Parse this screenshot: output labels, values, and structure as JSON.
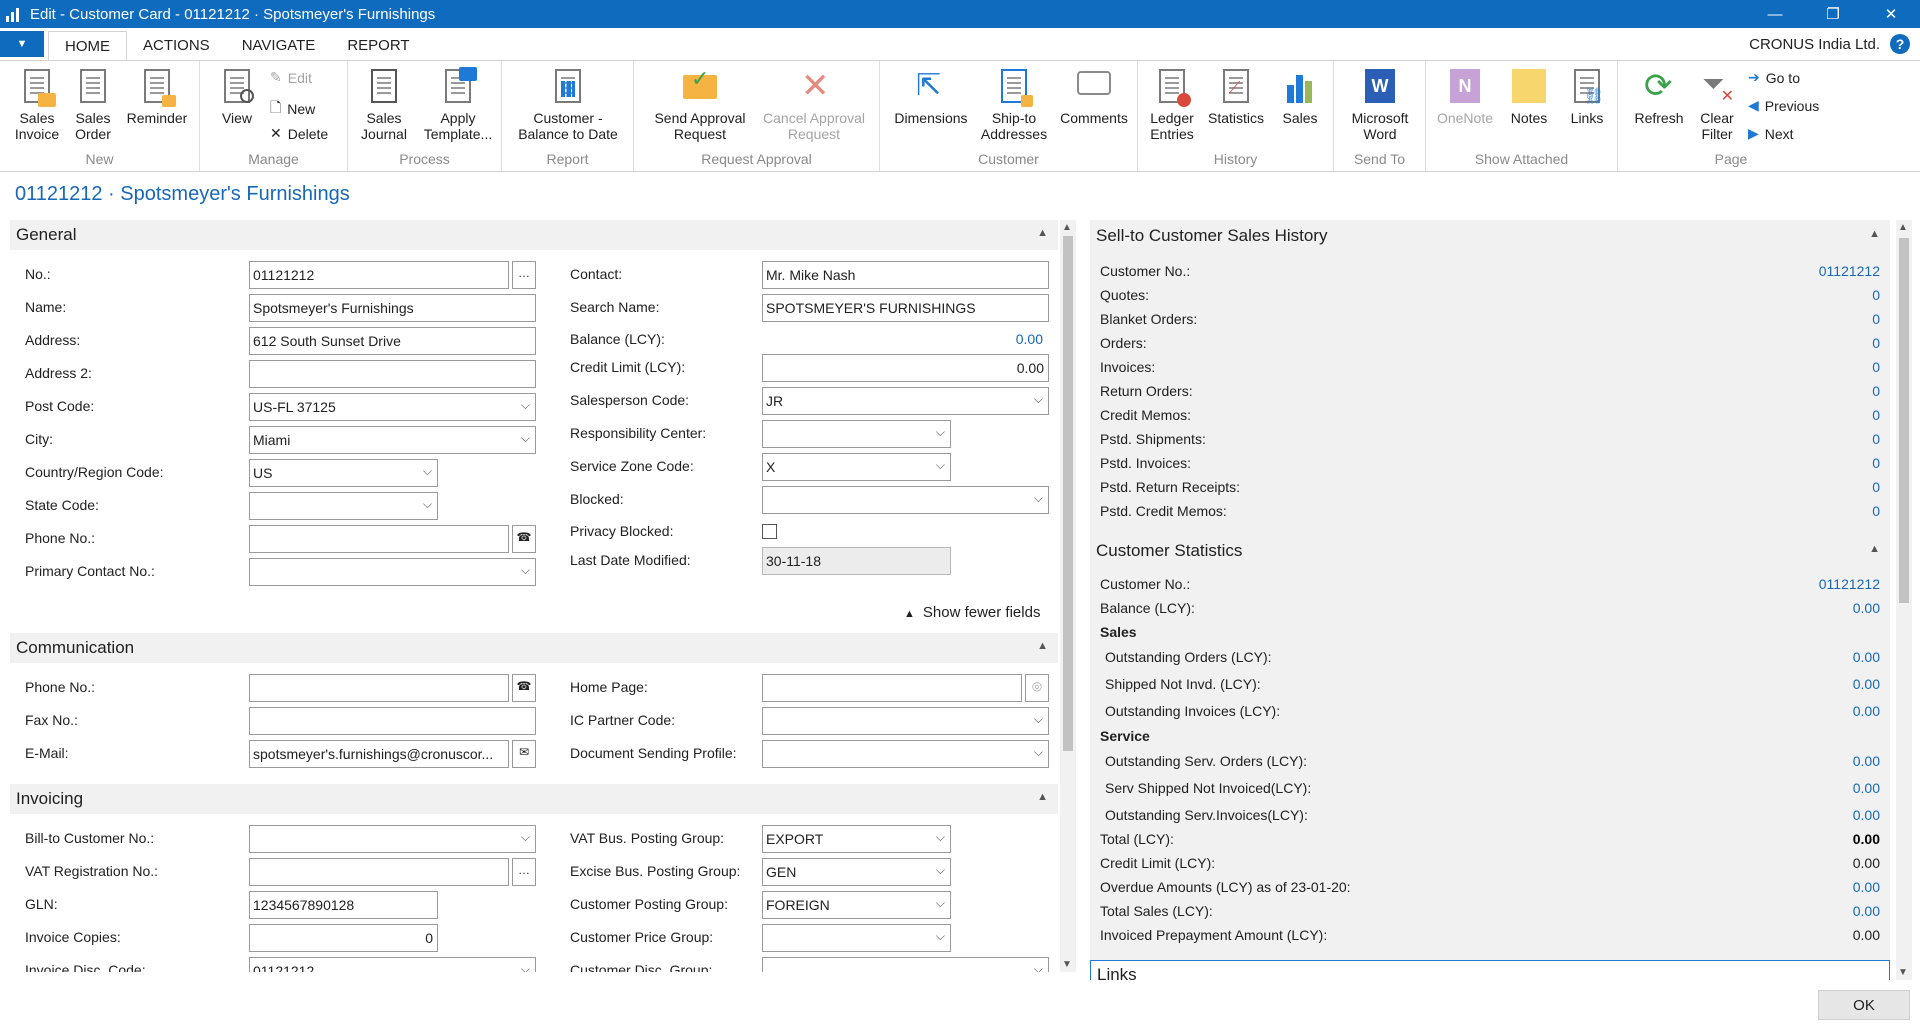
{
  "window": {
    "title": "Edit - Customer Card - 01121212 · Spotsmeyer's Furnishings",
    "minimize": "—",
    "restore": "❐",
    "close": "✕"
  },
  "ribbon_tabs": [
    "HOME",
    "ACTIONS",
    "NAVIGATE",
    "REPORT"
  ],
  "company": "CRONUS India Ltd.",
  "help": "?",
  "app_menu": "▼",
  "ribbon": {
    "new": {
      "label": "New",
      "sales_invoice": "Sales\nInvoice",
      "sales_order": "Sales\nOrder",
      "reminder": "Reminder"
    },
    "manage": {
      "label": "Manage",
      "view": "View",
      "edit": "Edit",
      "new": "New",
      "delete": "Delete"
    },
    "process": {
      "label": "Process",
      "sales_journal": "Sales\nJournal",
      "apply_template": "Apply\nTemplate..."
    },
    "report": {
      "label": "Report",
      "customer_balance": "Customer -\nBalance to Date"
    },
    "request_approval": {
      "label": "Request Approval",
      "send": "Send Approval\nRequest",
      "cancel": "Cancel Approval\nRequest"
    },
    "customer": {
      "label": "Customer",
      "dimensions": "Dimensions",
      "ship_to": "Ship-to\nAddresses",
      "comments": "Comments"
    },
    "history": {
      "label": "History",
      "ledger_entries": "Ledger\nEntries",
      "statistics": "Statistics",
      "sales": "Sales"
    },
    "send_to": {
      "label": "Send To",
      "word": "Microsoft\nWord"
    },
    "show_attached": {
      "label": "Show Attached",
      "onenote": "OneNote",
      "notes": "Notes",
      "links": "Links"
    },
    "page": {
      "label": "Page",
      "refresh": "Refresh",
      "clear_filter": "Clear\nFilter",
      "go_to": "Go to",
      "previous": "Previous",
      "next": "Next"
    }
  },
  "page_title": "01121212 · Spotsmeyer's Furnishings",
  "general": {
    "title": "General",
    "no_label": "No.:",
    "no": "01121212",
    "name_label": "Name:",
    "name": "Spotsmeyer's Furnishings",
    "address_label": "Address:",
    "address": "612 South Sunset Drive",
    "address2_label": "Address 2:",
    "address2": "",
    "post_code_label": "Post Code:",
    "post_code": "US-FL 37125",
    "city_label": "City:",
    "city": "Miami",
    "country_label": "Country/Region Code:",
    "country": "US",
    "state_label": "State Code:",
    "state": "",
    "phone_label": "Phone No.:",
    "phone": "",
    "primary_contact_label": "Primary Contact No.:",
    "primary_contact": "",
    "contact_label": "Contact:",
    "contact": "Mr. Mike Nash",
    "search_name_label": "Search Name:",
    "search_name": "SPOTSMEYER'S FURNISHINGS",
    "balance_label": "Balance (LCY):",
    "balance": "0.00",
    "credit_limit_label": "Credit Limit (LCY):",
    "credit_limit": "0.00",
    "salesperson_label": "Salesperson Code:",
    "salesperson": "JR",
    "responsibility_label": "Responsibility Center:",
    "responsibility": "",
    "service_zone_label": "Service Zone Code:",
    "service_zone": "X",
    "blocked_label": "Blocked:",
    "blocked": "",
    "privacy_blocked_label": "Privacy Blocked:",
    "last_modified_label": "Last Date Modified:",
    "last_modified": "30-11-18",
    "show_fewer": "Show fewer fields"
  },
  "communication": {
    "title": "Communication",
    "phone_label": "Phone No.:",
    "phone": "",
    "fax_label": "Fax No.:",
    "fax": "",
    "email_label": "E-Mail:",
    "email": "spotsmeyer's.furnishings@cronuscor...",
    "home_page_label": "Home Page:",
    "home_page": "",
    "ic_partner_label": "IC Partner Code:",
    "ic_partner": "",
    "doc_profile_label": "Document Sending Profile:",
    "doc_profile": ""
  },
  "invoicing": {
    "title": "Invoicing",
    "bill_to_label": "Bill-to Customer No.:",
    "bill_to": "",
    "vat_reg_label": "VAT Registration No.:",
    "vat_reg": "",
    "gln_label": "GLN:",
    "gln": "1234567890128",
    "invoice_copies_label": "Invoice Copies:",
    "invoice_copies": "0",
    "invoice_disc_label": "Invoice Disc. Code:",
    "invoice_disc": "01121212",
    "vat_bus_label": "VAT Bus. Posting Group:",
    "vat_bus": "EXPORT",
    "excise_label": "Excise Bus. Posting Group:",
    "excise": "GEN",
    "cust_posting_label": "Customer Posting Group:",
    "cust_posting": "FOREIGN",
    "price_group_label": "Customer Price Group:",
    "price_group": "",
    "disc_group_label": "Customer Disc. Group:",
    "disc_group": ""
  },
  "sales_history": {
    "title": "Sell-to Customer Sales History",
    "rows": [
      {
        "label": "Customer No.:",
        "value": "01121212"
      },
      {
        "label": "Quotes:",
        "value": "0"
      },
      {
        "label": "Blanket Orders:",
        "value": "0"
      },
      {
        "label": "Orders:",
        "value": "0"
      },
      {
        "label": "Invoices:",
        "value": "0"
      },
      {
        "label": "Return Orders:",
        "value": "0"
      },
      {
        "label": "Credit Memos:",
        "value": "0"
      },
      {
        "label": "Pstd. Shipments:",
        "value": "0"
      },
      {
        "label": "Pstd. Invoices:",
        "value": "0"
      },
      {
        "label": "Pstd. Return Receipts:",
        "value": "0"
      },
      {
        "label": "Pstd. Credit Memos:",
        "value": "0"
      }
    ]
  },
  "customer_statistics": {
    "title": "Customer Statistics",
    "customer_no_label": "Customer No.:",
    "customer_no": "01121212",
    "balance_label": "Balance (LCY):",
    "balance": "0.00",
    "sales_header": "Sales",
    "outstanding_orders_label": "Outstanding Orders (LCY):",
    "outstanding_orders": "0.00",
    "shipped_not_invd_label": "Shipped Not Invd. (LCY):",
    "shipped_not_invd": "0.00",
    "outstanding_invoices_label": "Outstanding Invoices (LCY):",
    "outstanding_invoices": "0.00",
    "service_header": "Service",
    "outstanding_serv_orders_label": "Outstanding Serv. Orders (LCY):",
    "outstanding_serv_orders": "0.00",
    "serv_shipped_label": "Serv Shipped Not Invoiced(LCY):",
    "serv_shipped": "0.00",
    "outstanding_serv_inv_label": "Outstanding Serv.Invoices(LCY):",
    "outstanding_serv_inv": "0.00",
    "total_label": "Total (LCY):",
    "total": "0.00",
    "credit_limit_label": "Credit Limit (LCY):",
    "credit_limit": "0.00",
    "overdue_label": "Overdue Amounts (LCY) as of 23-01-20:",
    "overdue": "0.00",
    "total_sales_label": "Total Sales (LCY):",
    "total_sales": "0.00",
    "invoiced_prepayment_label": "Invoiced Prepayment Amount (LCY):",
    "invoiced_prepayment": "0.00"
  },
  "links_box": {
    "title": "Links"
  },
  "ok_button": "OK",
  "colors": {
    "accent": "#0e6bbd",
    "link": "#1868b8",
    "panel": "#f1f1f1"
  }
}
